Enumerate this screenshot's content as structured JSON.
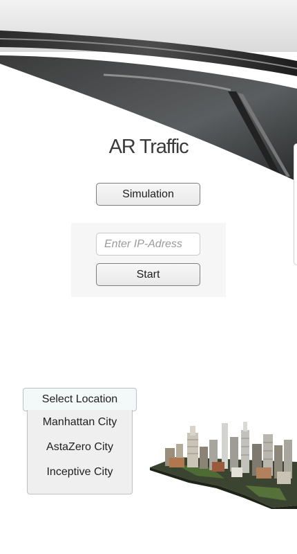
{
  "header": {
    "title": "AR Traffic"
  },
  "simulation_button": {
    "label": "Simulation"
  },
  "connect_panel": {
    "ip_placeholder": "Enter IP-Adress",
    "ip_value": "",
    "start_label": "Start"
  },
  "location": {
    "select_label": "Select Location",
    "options": [
      "Manhattan City",
      "AstaZero City",
      "Inceptive City"
    ]
  },
  "images": {
    "header_image": "car-roof-photo",
    "city_image": "city-3d-model"
  },
  "colors": {
    "title_text": "#3a3a3a",
    "button_border": "#7c7c7c",
    "panel_bg": "#f6f6f6",
    "dropdown_bg": "#efefef"
  }
}
